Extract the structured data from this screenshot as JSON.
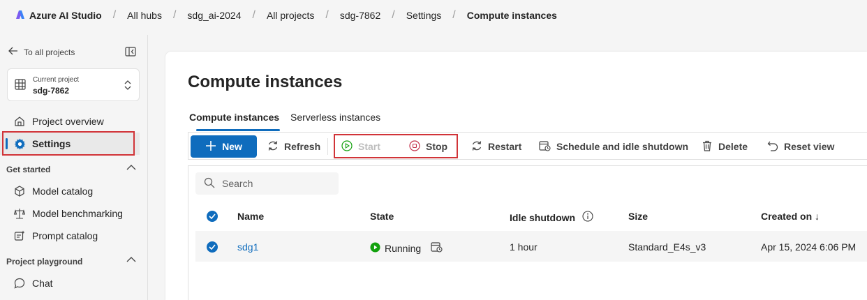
{
  "topbar": {
    "app_name": "Azure AI Studio",
    "breadcrumbs": [
      "All hubs",
      "sdg_ai-2024",
      "All projects",
      "sdg-7862",
      "Settings"
    ],
    "current": "Compute instances"
  },
  "sidebar": {
    "back_label": "To all projects",
    "project": {
      "label": "Current project",
      "name": "sdg-7862"
    },
    "items": [
      {
        "label": "Project overview",
        "icon": "home-icon"
      },
      {
        "label": "Settings",
        "icon": "gear-icon",
        "active": true
      }
    ],
    "sections": [
      {
        "title": "Get started",
        "items": [
          {
            "label": "Model catalog",
            "icon": "cube-icon"
          },
          {
            "label": "Model benchmarking",
            "icon": "scale-icon"
          },
          {
            "label": "Prompt catalog",
            "icon": "prompt-icon"
          }
        ]
      },
      {
        "title": "Project playground",
        "items": [
          {
            "label": "Chat",
            "icon": "chat-icon"
          }
        ]
      }
    ]
  },
  "main": {
    "title": "Compute instances",
    "tabs": [
      "Compute instances",
      "Serverless instances"
    ],
    "toolbar": {
      "new": "New",
      "refresh": "Refresh",
      "start": "Start",
      "stop": "Stop",
      "restart": "Restart",
      "schedule": "Schedule and idle shutdown",
      "delete": "Delete",
      "reset": "Reset view"
    },
    "search_placeholder": "Search",
    "columns": [
      "Name",
      "State",
      "Idle shutdown",
      "Size",
      "Created on ↓"
    ],
    "rows": [
      {
        "name": "sdg1",
        "state": "Running",
        "idle": "1 hour",
        "size": "Standard_E4s_v3",
        "created": "Apr 15, 2024 6:06 PM"
      }
    ]
  },
  "colors": {
    "accent": "#0f6cbd",
    "highlight": "#d13438",
    "running": "#13a10e"
  }
}
